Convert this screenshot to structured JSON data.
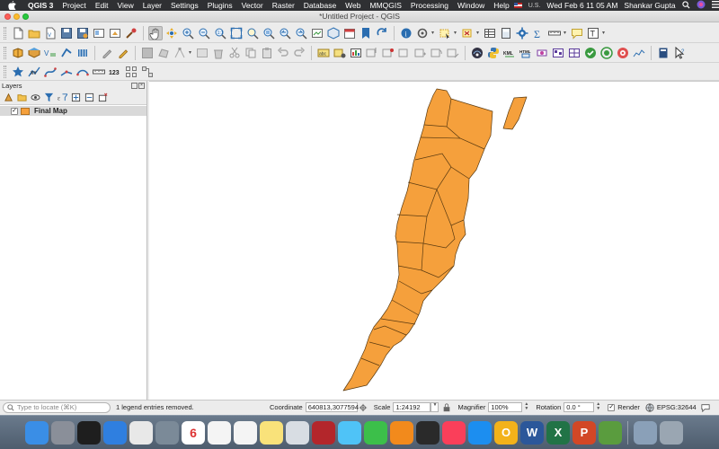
{
  "menubar": {
    "apple_icon": "apple-icon",
    "app_name": "QGIS 3",
    "items": [
      "Project",
      "Edit",
      "View",
      "Layer",
      "Settings",
      "Plugins",
      "Vector",
      "Raster",
      "Database",
      "Web",
      "MMQGIS",
      "Processing",
      "Window",
      "Help"
    ],
    "input_source": "U.S.",
    "datetime": "Wed Feb 6  11 05 AM",
    "user": "Shankar Gupta"
  },
  "window": {
    "title": "*Untitled Project - QGIS"
  },
  "layers_panel": {
    "title": "Layers",
    "layers": [
      {
        "name": "Final Map",
        "checked": true,
        "color": "#f5a03c"
      }
    ]
  },
  "map": {
    "fill_color": "#f5a03c",
    "stroke_color": "#5a3a10",
    "background": "#ffffff"
  },
  "statusbar": {
    "locator_placeholder": "Type to locate (⌘K)",
    "message": "1 legend entries removed.",
    "coordinate_label": "Coordinate",
    "coordinate_value": "640813,3077594",
    "scale_label": "Scale",
    "scale_value": "1:24192",
    "magnifier_label": "Magnifier",
    "magnifier_value": "100%",
    "rotation_label": "Rotation",
    "rotation_value": "0.0 °",
    "render_label": "Render",
    "render_checked": true,
    "crs": "EPSG:32644"
  },
  "dock": {
    "apps": [
      {
        "name": "Finder",
        "color": "#3a8ee6"
      },
      {
        "name": "Launchpad",
        "color": "#8a8f99"
      },
      {
        "name": "Mission Control",
        "color": "#1e1e1e"
      },
      {
        "name": "Safari",
        "color": "#2f7fe0"
      },
      {
        "name": "Chrome",
        "color": "#e8e8e8"
      },
      {
        "name": "Image Capture",
        "color": "#7b8a98"
      },
      {
        "name": "Calendar",
        "color": "#ffffff",
        "text": "6"
      },
      {
        "name": "Reminders",
        "color": "#f4f4f4"
      },
      {
        "name": "Photos",
        "color": "#f4f4f4"
      },
      {
        "name": "Notes",
        "color": "#f9e27a"
      },
      {
        "name": "Preview",
        "color": "#d8dde3"
      },
      {
        "name": "Photo Booth",
        "color": "#b3262b"
      },
      {
        "name": "Messages",
        "color": "#4fc3f7"
      },
      {
        "name": "FaceTime",
        "color": "#3cbf4a"
      },
      {
        "name": "Books",
        "color": "#f28a1c"
      },
      {
        "name": "Photo Booth 2",
        "color": "#2a2a2a"
      },
      {
        "name": "Music",
        "color": "#fa3f5a"
      },
      {
        "name": "App Store",
        "color": "#1c8ef0"
      },
      {
        "name": "Outlook",
        "color": "#f3b21a",
        "text": "O"
      },
      {
        "name": "Word",
        "color": "#2b579a",
        "text": "W"
      },
      {
        "name": "Excel",
        "color": "#217346",
        "text": "X"
      },
      {
        "name": "PowerPoint",
        "color": "#d24726",
        "text": "P"
      },
      {
        "name": "QGIS",
        "color": "#5a9c3e"
      },
      {
        "name": "Downloads",
        "color": "#8aa0b8"
      },
      {
        "name": "Trash",
        "color": "#9aa6b2"
      }
    ]
  }
}
